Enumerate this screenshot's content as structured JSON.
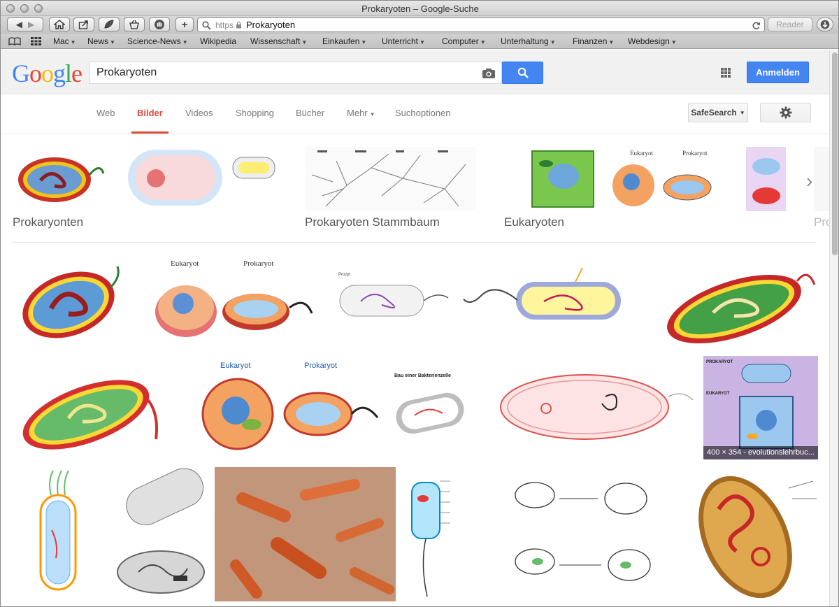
{
  "window": {
    "title": "Prokaryoten – Google-Suche"
  },
  "toolbar": {
    "https": "https",
    "url": "Prokaryoten",
    "reader": "Reader"
  },
  "bookmarks": [
    "Mac",
    "News",
    "Science-News",
    "Wikipedia",
    "Wissenschaft",
    "Einkaufen",
    "Unterricht",
    "Computer",
    "Unterhaltung",
    "Finanzen",
    "Webdesign"
  ],
  "google": {
    "logo": "Google",
    "query": "Prokaryoten",
    "signin": "Anmelden"
  },
  "tabs": {
    "web": "Web",
    "bilder": "Bilder",
    "videos": "Videos",
    "shopping": "Shopping",
    "buecher": "Bücher",
    "mehr": "Mehr",
    "suchoptionen": "Suchoptionen"
  },
  "safesearch": "SafeSearch",
  "topics": [
    "Prokaryonten",
    "Prokaryoten Stammbaum",
    "Eukaryoten",
    "Pro"
  ],
  "thumb_caption": "400 × 354 - evolutionslehrbuc...",
  "colors": {
    "accent_red": "#dd4b39",
    "button_blue": "#4485f2"
  }
}
